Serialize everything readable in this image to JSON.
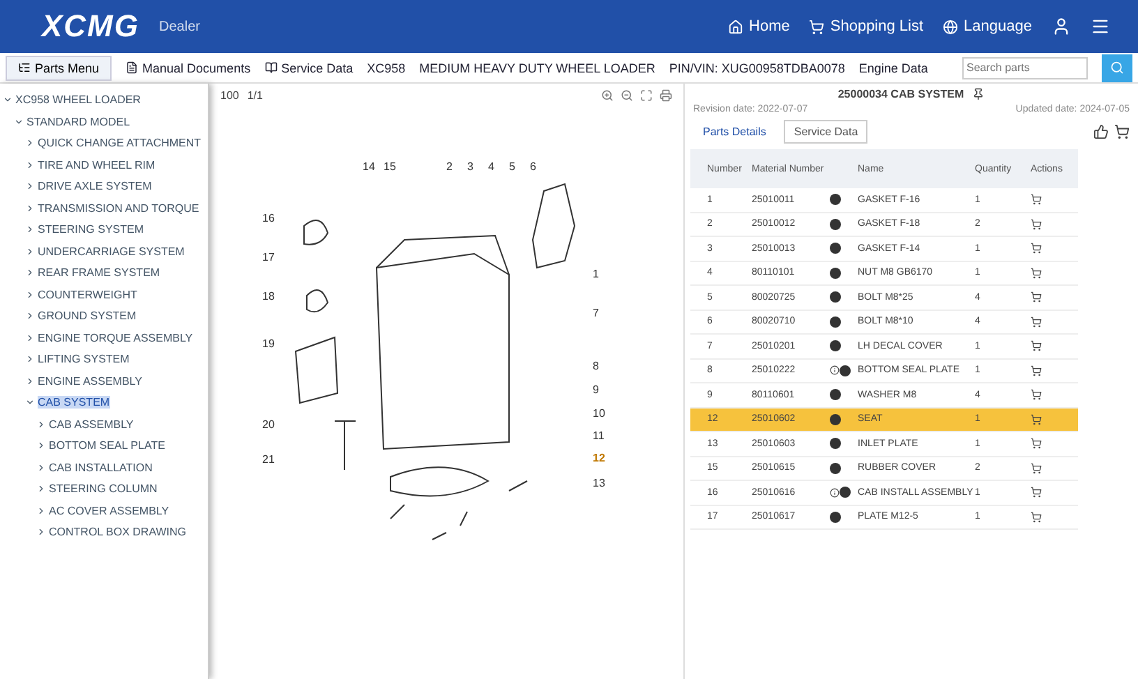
{
  "header": {
    "brand": "XCMG",
    "subtitle": "Dealer",
    "nav": [
      {
        "kind": "home",
        "label": "Home"
      },
      {
        "kind": "cart",
        "label": "Shopping List"
      },
      {
        "kind": "language",
        "label": "Language"
      }
    ]
  },
  "toolbar": {
    "menu": "Parts Menu",
    "links": [
      {
        "kind": "doc",
        "label": "Manual Documents"
      },
      {
        "kind": "book",
        "label": "Service Data"
      }
    ],
    "model": "XC958",
    "description": "MEDIUM HEAVY DUTY WHEEL LOADER",
    "pin": "PIN/VIN: XUG00958TDBA0078",
    "engine": "Engine Data",
    "search": {
      "placeholder": "Search parts"
    }
  },
  "tree": {
    "items": [
      {
        "label": "XC958 WHEEL LOADER",
        "expanded": true,
        "selected": false,
        "children": [
          {
            "label": "STANDARD MODEL",
            "expanded": true,
            "selected": false,
            "children": [
              {
                "label": "QUICK CHANGE ATTACHMENT",
                "expanded": false,
                "selected": false
              },
              {
                "label": "TIRE AND WHEEL RIM",
                "expanded": false,
                "selected": false
              },
              {
                "label": "DRIVE AXLE SYSTEM",
                "expanded": false,
                "selected": false
              },
              {
                "label": "TRANSMISSION AND TORQUE",
                "expanded": false,
                "selected": false
              },
              {
                "label": "STEERING SYSTEM",
                "expanded": false,
                "selected": false
              },
              {
                "label": "UNDERCARRIAGE SYSTEM",
                "expanded": false,
                "selected": false
              },
              {
                "label": "REAR FRAME SYSTEM",
                "expanded": false,
                "selected": false
              },
              {
                "label": "COUNTERWEIGHT",
                "expanded": false,
                "selected": false
              },
              {
                "label": "GROUND SYSTEM",
                "expanded": false,
                "selected": false
              },
              {
                "label": "ENGINE TORQUE ASSEMBLY",
                "expanded": false,
                "selected": false
              },
              {
                "label": "LIFTING SYSTEM",
                "expanded": false,
                "selected": false
              },
              {
                "label": "ENGINE ASSEMBLY",
                "expanded": false,
                "selected": false
              },
              {
                "label": "CAB SYSTEM",
                "expanded": true,
                "selected": true,
                "children": [
                  {
                    "label": "CAB ASSEMBLY",
                    "expanded": false,
                    "selected": false
                  },
                  {
                    "label": "BOTTOM SEAL PLATE",
                    "expanded": false,
                    "selected": false
                  },
                  {
                    "label": "CAB INSTALLATION",
                    "expanded": false,
                    "selected": false
                  },
                  {
                    "label": "STEERING COLUMN",
                    "expanded": false,
                    "selected": false
                  },
                  {
                    "label": "AC COVER ASSEMBLY",
                    "expanded": false,
                    "selected": false
                  },
                  {
                    "label": "CONTROL BOX DRAWING",
                    "expanded": false,
                    "selected": false
                  }
                ]
              }
            ]
          }
        ]
      }
    ]
  },
  "diagram": {
    "zoom": "100",
    "page": "1/1",
    "callouts": [
      {
        "label": "1",
        "selected": false
      },
      {
        "label": "2",
        "selected": false
      },
      {
        "label": "3",
        "selected": false
      },
      {
        "label": "4",
        "selected": false
      },
      {
        "label": "5",
        "selected": false
      },
      {
        "label": "6",
        "selected": false
      },
      {
        "label": "7",
        "selected": false
      },
      {
        "label": "8",
        "selected": false
      },
      {
        "label": "9",
        "selected": false
      },
      {
        "label": "10",
        "selected": false
      },
      {
        "label": "11",
        "selected": false
      },
      {
        "label": "12",
        "selected": true
      },
      {
        "label": "13",
        "selected": false
      },
      {
        "label": "14",
        "selected": false
      },
      {
        "label": "15",
        "selected": false
      },
      {
        "label": "16",
        "selected": false
      },
      {
        "label": "17",
        "selected": false
      },
      {
        "label": "18",
        "selected": false
      },
      {
        "label": "19",
        "selected": false
      },
      {
        "label": "20",
        "selected": false
      },
      {
        "label": "21",
        "selected": false
      }
    ]
  },
  "panel": {
    "title": "25000034 CAB SYSTEM",
    "revision": "Revision date: 2022-07-07",
    "updated": "Updated date: 2024-07-05",
    "tabs": [
      {
        "label": "Parts Details",
        "selected": true
      },
      {
        "label": "Service Data",
        "selected": false
      }
    ],
    "columns": [
      "Number",
      "Material Number",
      "Name",
      "Quantity",
      "Actions"
    ],
    "rows": [
      {
        "number": "1",
        "material": "25010011",
        "note": false,
        "name": "GASKET F-16",
        "quantity": "1",
        "selected": false
      },
      {
        "number": "2",
        "material": "25010012",
        "note": false,
        "name": "GASKET F-18",
        "quantity": "2",
        "selected": false
      },
      {
        "number": "3",
        "material": "25010013",
        "note": false,
        "name": "GASKET F-14",
        "quantity": "1",
        "selected": false
      },
      {
        "number": "4",
        "material": "80110101",
        "note": false,
        "name": "NUT M8 GB6170",
        "quantity": "1",
        "selected": false
      },
      {
        "number": "5",
        "material": "80020725",
        "note": false,
        "name": "BOLT M8*25",
        "quantity": "4",
        "selected": false
      },
      {
        "number": "6",
        "material": "80020710",
        "note": false,
        "name": "BOLT M8*10",
        "quantity": "4",
        "selected": false
      },
      {
        "number": "7",
        "material": "25010201",
        "note": false,
        "name": "LH DECAL COVER",
        "quantity": "1",
        "selected": false
      },
      {
        "number": "8",
        "material": "25010222",
        "note": true,
        "name": "BOTTOM SEAL PLATE",
        "quantity": "1",
        "selected": false
      },
      {
        "number": "9",
        "material": "80110601",
        "note": false,
        "name": "WASHER M8",
        "quantity": "4",
        "selected": false
      },
      {
        "number": "12",
        "material": "25010602",
        "note": false,
        "name": "SEAT",
        "quantity": "1",
        "selected": true
      },
      {
        "number": "13",
        "material": "25010603",
        "note": false,
        "name": "INLET PLATE",
        "quantity": "1",
        "selected": false
      },
      {
        "number": "15",
        "material": "25010615",
        "note": false,
        "name": "RUBBER COVER",
        "quantity": "2",
        "selected": false
      },
      {
        "number": "16",
        "material": "25010616",
        "note": true,
        "name": "CAB INSTALL ASSEMBLY",
        "quantity": "1",
        "selected": false
      },
      {
        "number": "17",
        "material": "25010617",
        "note": false,
        "name": "PLATE M12-5",
        "quantity": "1",
        "selected": false
      }
    ]
  }
}
